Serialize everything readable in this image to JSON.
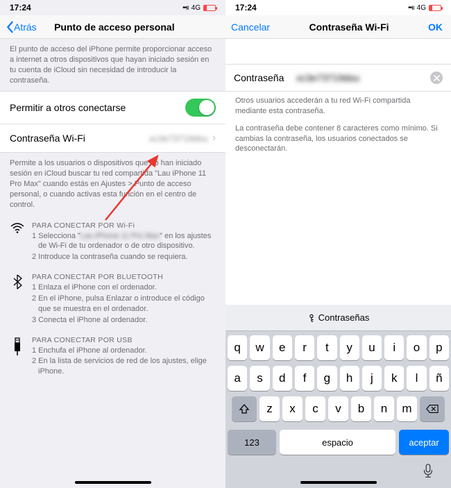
{
  "status": {
    "time": "17:24",
    "network": "4G"
  },
  "left": {
    "nav": {
      "back": "Atrás",
      "title": "Punto de acceso personal"
    },
    "top_desc": "El punto de acceso del iPhone permite proporcionar acceso a internet a otros dispositivos que hayan iniciado sesión en tu cuenta de iCloud sin necesidad de introducir la contraseña.",
    "toggle_label": "Permitir a otros conectarse",
    "wifi_pwd_label": "Contraseña Wi-Fi",
    "wifi_pwd_value": "xc3e73719dsu",
    "mid_desc": "Permite a los usuarios o dispositivos que no han iniciado sesión en iCloud buscar tu red compartida \"Lau iPhone 11 Pro Max\" cuando estás en Ajustes > Punto de acceso personal, o cuando activas esta función en el centro de control.",
    "wifi": {
      "title": "PARA CONECTAR POR Wi-Fi",
      "steps": [
        "1 Selecciona \"Lau iPhone 11 Pro Max\" en los ajustes de Wi-Fi de tu ordenador o de otro dispositivo.",
        "2 Introduce la contraseña cuando se requiera."
      ]
    },
    "bt": {
      "title": "PARA CONECTAR POR BLUETOOTH",
      "steps": [
        "1 Enlaza el iPhone con el ordenador.",
        "2 En el iPhone, pulsa Enlazar o introduce el código que se muestra en el ordenador.",
        "3 Conecta el iPhone al ordenador."
      ]
    },
    "usb": {
      "title": "PARA CONECTAR POR USB",
      "steps": [
        "1 Enchufa el iPhone al ordenador.",
        "2 En la lista de servicios de red de los ajustes, elige iPhone."
      ]
    }
  },
  "right": {
    "nav": {
      "cancel": "Cancelar",
      "title": "Contraseña Wi-Fi",
      "ok": "OK"
    },
    "field_label": "Contraseña",
    "field_value": "xc3e73719dsu",
    "desc1": "Otros usuarios accederán a tu red Wi-Fi compartida mediante esta contraseña.",
    "desc2": "La contraseña debe contener 8 caracteres como mínimo. Si cambias la contraseña, los usuarios conectados se desconectarán.",
    "kb": {
      "suggestion": "Contraseñas",
      "row1": [
        "q",
        "w",
        "e",
        "r",
        "t",
        "y",
        "u",
        "i",
        "o",
        "p"
      ],
      "row2": [
        "a",
        "s",
        "d",
        "f",
        "g",
        "h",
        "j",
        "k",
        "l",
        "ñ"
      ],
      "row3": [
        "z",
        "x",
        "c",
        "v",
        "b",
        "n",
        "m"
      ],
      "numkey": "123",
      "space": "espacio",
      "accept": "aceptar"
    }
  }
}
